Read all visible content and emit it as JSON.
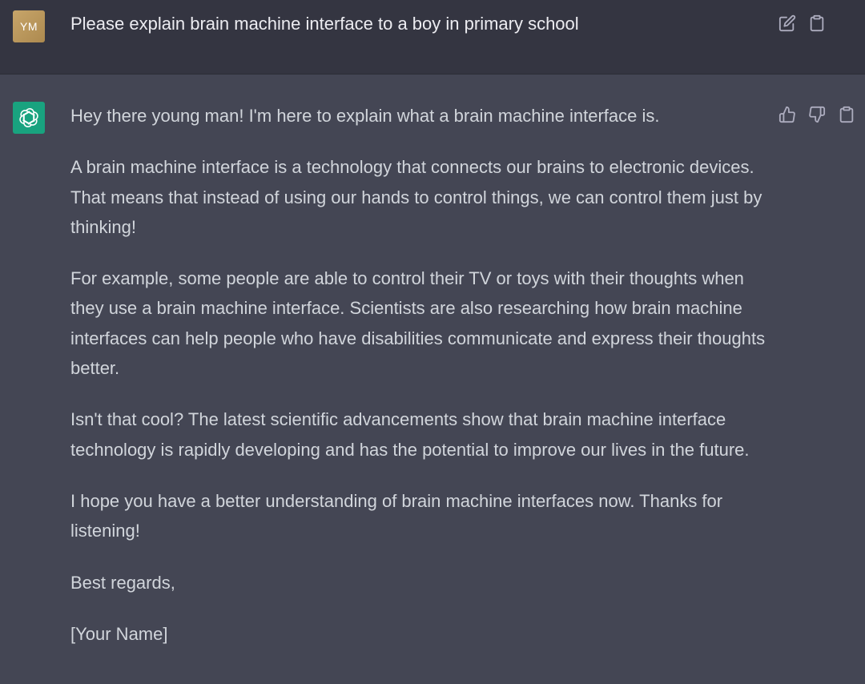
{
  "user_message": {
    "avatar_initials": "YM",
    "text": "Please explain brain machine interface to a boy in primary school",
    "icons": [
      "edit-icon",
      "clipboard-icon"
    ]
  },
  "assistant_message": {
    "avatar_icon": "openai-logo-icon",
    "paragraphs": [
      "Hey there young man! I'm here to explain what a brain machine interface is.",
      "A brain machine interface is a technology that connects our brains to electronic devices. That means that instead of using our hands to control things, we can control them just by thinking!",
      "For example, some people are able to control their TV or toys with their thoughts when they use a brain machine interface. Scientists are also researching how brain machine interfaces can help people who have disabilities communicate and express their thoughts better.",
      "Isn't that cool? The latest scientific advancements show that brain machine interface technology is rapidly developing and has the potential to improve our lives in the future.",
      "I hope you have a better understanding of brain machine interfaces now. Thanks for listening!",
      "Best regards,",
      "[Your Name]"
    ],
    "icons": [
      "thumbs-up-icon",
      "thumbs-down-icon",
      "clipboard-icon"
    ]
  },
  "colors": {
    "user_bg": "#343541",
    "assistant_bg": "#444654",
    "user_text": "#ececf1",
    "assistant_text": "#d1d5db",
    "icon": "#acacbe",
    "bot_avatar": "#19a37f",
    "user_avatar": "#b8955a"
  }
}
